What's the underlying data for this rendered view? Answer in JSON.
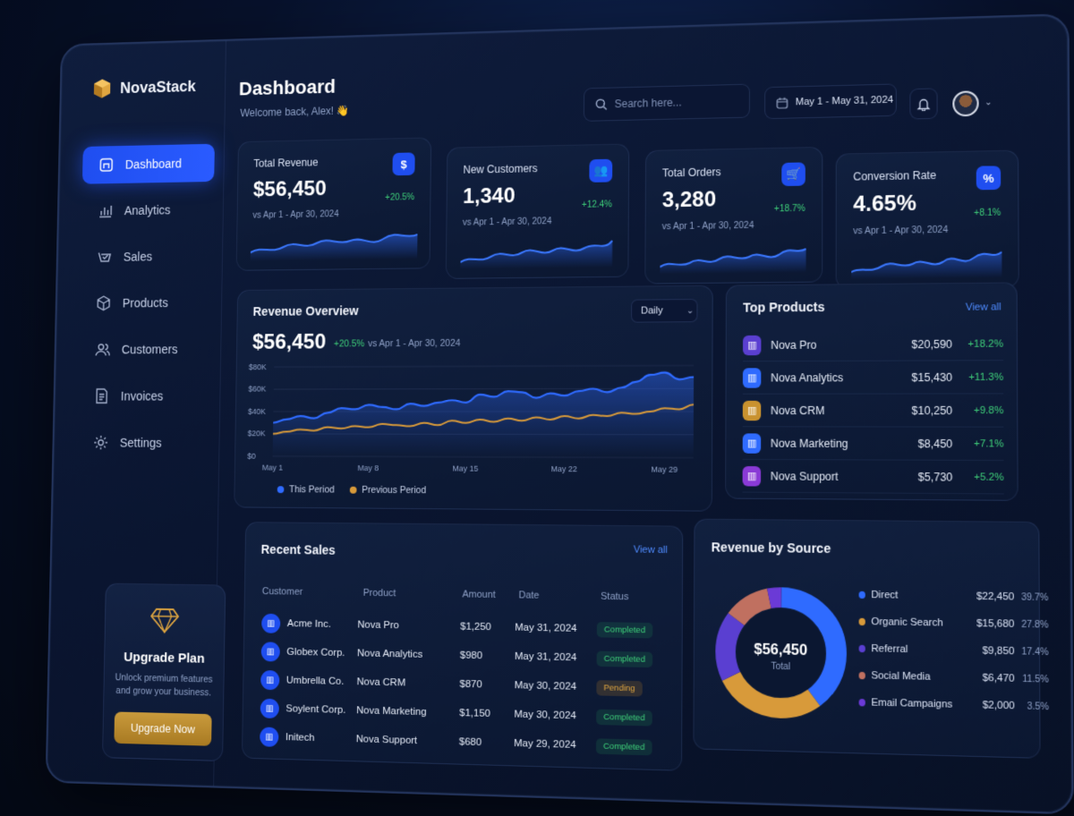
{
  "app": {
    "name": "NovaStack"
  },
  "sidebar": {
    "items": [
      {
        "label": "Dashboard",
        "icon": "dashboard-icon",
        "active": true
      },
      {
        "label": "Analytics",
        "icon": "analytics-icon"
      },
      {
        "label": "Sales",
        "icon": "sales-icon"
      },
      {
        "label": "Products",
        "icon": "products-icon"
      },
      {
        "label": "Customers",
        "icon": "customers-icon"
      },
      {
        "label": "Invoices",
        "icon": "invoices-icon"
      },
      {
        "label": "Settings",
        "icon": "settings-icon"
      }
    ],
    "upgrade": {
      "title": "Upgrade Plan",
      "text": "Unlock premium features and grow your business.",
      "button": "Upgrade Now"
    }
  },
  "header": {
    "title": "Dashboard",
    "subtitle": "Welcome back, Alex! 👋",
    "search_placeholder": "Search here...",
    "date_range": "May 1 - May 31, 2024"
  },
  "kpis": [
    {
      "title": "Total Revenue",
      "value": "$56,450",
      "change": "+20.5%",
      "compare": "vs Apr 1 - Apr 30, 2024",
      "icon": "$"
    },
    {
      "title": "New Customers",
      "value": "1,340",
      "change": "+12.4%",
      "compare": "vs Apr 1 - Apr 30, 2024",
      "icon": "👥"
    },
    {
      "title": "Total Orders",
      "value": "3,280",
      "change": "+18.7%",
      "compare": "vs Apr 1 - Apr 30, 2024",
      "icon": "🛒"
    },
    {
      "title": "Conversion Rate",
      "value": "4.65%",
      "change": "+8.1%",
      "compare": "vs Apr 1 - Apr 30, 2024",
      "icon": "%"
    }
  ],
  "revenue_overview": {
    "title": "Revenue Overview",
    "period": "Daily",
    "value": "$56,450",
    "change": "+20.5%",
    "compare": "vs Apr 1 - Apr 30, 2024",
    "legend": [
      "This Period",
      "Previous Period"
    ]
  },
  "chart_data": [
    {
      "type": "line",
      "title": "Revenue Overview",
      "x": [
        "May 1",
        "May 2",
        "May 3",
        "May 4",
        "May 5",
        "May 6",
        "May 7",
        "May 8",
        "May 9",
        "May 10",
        "May 11",
        "May 12",
        "May 13",
        "May 14",
        "May 15",
        "May 16",
        "May 17",
        "May 18",
        "May 19",
        "May 20",
        "May 21",
        "May 22",
        "May 23",
        "May 24",
        "May 25",
        "May 26",
        "May 27",
        "May 28",
        "May 29",
        "May 30",
        "May 31"
      ],
      "x_ticks": [
        "May 1",
        "May 8",
        "May 15",
        "May 22",
        "May 29"
      ],
      "y_ticks": [
        "$0",
        "$20K",
        "$40K",
        "$60K",
        "$80K"
      ],
      "ylim": [
        0,
        80000
      ],
      "series": [
        {
          "name": "This Period",
          "color": "#2f6bff",
          "values": [
            30000,
            33000,
            36000,
            34000,
            39000,
            43000,
            42000,
            46000,
            44000,
            42000,
            47000,
            45000,
            48000,
            50000,
            48000,
            55000,
            53000,
            58000,
            57000,
            52000,
            56000,
            54000,
            58000,
            60000,
            57000,
            61000,
            66000,
            72000,
            74000,
            68000,
            70000
          ]
        },
        {
          "name": "Previous Period",
          "color": "#d89a3a",
          "values": [
            20000,
            22000,
            24000,
            23000,
            26000,
            25000,
            27000,
            26000,
            29000,
            28000,
            27000,
            30000,
            28000,
            32000,
            30000,
            33000,
            31000,
            34000,
            32000,
            35000,
            33000,
            36000,
            34000,
            37000,
            36000,
            39000,
            38000,
            40000,
            43000,
            42000,
            46000
          ]
        }
      ]
    },
    {
      "type": "pie",
      "title": "Revenue by Source",
      "center_value": "$56,450",
      "center_label": "Total",
      "categories": [
        "Direct",
        "Organic Search",
        "Referral",
        "Social Media",
        "Email Campaigns"
      ],
      "amounts": [
        "$22,450",
        "$15,680",
        "$9,850",
        "$6,470",
        "$2,000"
      ],
      "percent_labels": [
        "39.7%",
        "27.8%",
        "17.4%",
        "11.5%",
        "3.5%"
      ],
      "values": [
        39.7,
        27.8,
        17.4,
        11.5,
        3.5
      ],
      "colors": [
        "#2f6bff",
        "#d89a3a",
        "#5a3fd1",
        "#c07060",
        "#6b3ad6"
      ]
    }
  ],
  "top_products": {
    "title": "Top Products",
    "view_all": "View all",
    "items": [
      {
        "name": "Nova Pro",
        "revenue": "$20,590",
        "change": "+18.2%",
        "color": "#5a3fd1"
      },
      {
        "name": "Nova Analytics",
        "revenue": "$15,430",
        "change": "+11.3%",
        "color": "#2f6bff"
      },
      {
        "name": "Nova CRM",
        "revenue": "$10,250",
        "change": "+9.8%",
        "color": "#c9922f"
      },
      {
        "name": "Nova Marketing",
        "revenue": "$8,450",
        "change": "+7.1%",
        "color": "#2f6bff"
      },
      {
        "name": "Nova Support",
        "revenue": "$5,730",
        "change": "+5.2%",
        "color": "#8a3ad6"
      }
    ]
  },
  "recent_sales": {
    "title": "Recent Sales",
    "view_all": "View all",
    "columns": [
      "Customer",
      "Product",
      "Amount",
      "Date",
      "Status"
    ],
    "rows": [
      {
        "customer": "Acme Inc.",
        "product": "Nova Pro",
        "amount": "$1,250",
        "date": "May 31, 2024",
        "status": "Completed"
      },
      {
        "customer": "Globex Corp.",
        "product": "Nova Analytics",
        "amount": "$980",
        "date": "May 31, 2024",
        "status": "Completed"
      },
      {
        "customer": "Umbrella Co.",
        "product": "Nova CRM",
        "amount": "$870",
        "date": "May 30, 2024",
        "status": "Pending"
      },
      {
        "customer": "Soylent Corp.",
        "product": "Nova Marketing",
        "amount": "$1,150",
        "date": "May 30, 2024",
        "status": "Completed"
      },
      {
        "customer": "Initech",
        "product": "Nova Support",
        "amount": "$680",
        "date": "May 29, 2024",
        "status": "Completed"
      }
    ]
  },
  "revenue_by_source": {
    "title": "Revenue by Source"
  }
}
